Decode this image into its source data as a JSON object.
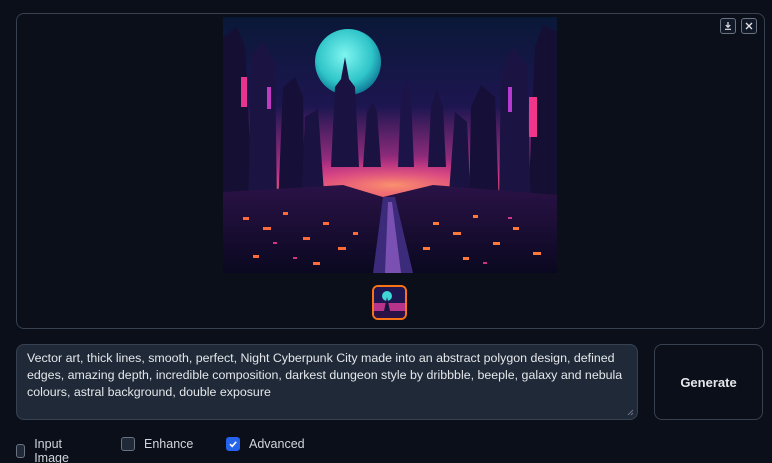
{
  "gallery": {
    "download_icon": "download-icon",
    "close_icon": "close-icon",
    "preview_image": "night cyberpunk city with moon",
    "thumbnail": "selected-thumbnail"
  },
  "prompt": {
    "value": "Vector art, thick lines, smooth, perfect, Night Cyberpunk City made into an abstract polygon design, defined edges, amazing depth, incredible composition, darkest dungeon style by dribbble, beeple, galaxy and nebula colours, astral background, double exposure"
  },
  "generate_button": {
    "label": "Generate"
  },
  "options": [
    {
      "label": "Input Image",
      "checked": false
    },
    {
      "label": "Enhance",
      "checked": false
    },
    {
      "label": "Advanced",
      "checked": true
    }
  ],
  "colors": {
    "background": "#0b0f19",
    "border": "#374151",
    "accent": "#2563eb",
    "thumbnail_border": "#f97316"
  }
}
